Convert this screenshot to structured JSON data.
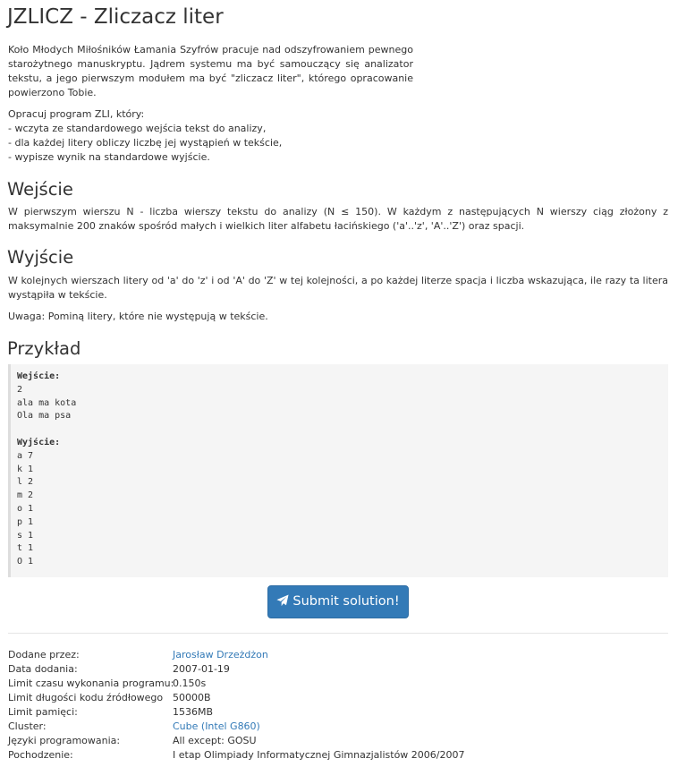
{
  "title": "JZLICZ - Zliczacz liter",
  "intro": "Koło Młodych Miłośników Łamania Szyfrów pracuje nad odszyfrowaniem pewnego starożytnego manuskryptu. Jądrem systemu ma być samouczący się analizator tekstu, a jego pierwszym modułem ma być \"zliczacz liter\", którego opracowanie powierzono Tobie.",
  "task": {
    "lead": "Opracuj program ZLI, który:",
    "items": [
      "- wczyta ze standardowego wejścia tekst do analizy,",
      "- dla każdej litery obliczy liczbę jej wystąpień w tekście,",
      "- wypisze wynik na standardowe wyjście."
    ]
  },
  "input_section": {
    "heading": "Wejście",
    "text": "W pierwszym wierszu N - liczba wierszy tekstu do analizy (N ≤ 150). W każdym z następujących N wierszy ciąg złożony z maksymalnie 200 znaków spośród małych i wielkich liter alfabetu łacińskiego ('a'..'z', 'A'..'Z') oraz spacji."
  },
  "output_section": {
    "heading": "Wyjście",
    "text": "W kolejnych wierszach litery od 'a' do 'z' i od 'A' do 'Z' w tej kolejności, a po każdej literze spacja i liczba wskazująca, ile razy ta litera wystąpiła w tekście.",
    "note": "Uwaga: Pominą litery, które nie występują w tekście."
  },
  "example": {
    "heading": "Przykład",
    "input_label": "Wejście:",
    "input_lines": [
      "2",
      "ala ma kota",
      "Ola ma psa"
    ],
    "output_label": "Wyjście:",
    "output_lines": [
      "a 7",
      "k 1",
      "l 2",
      "m 2",
      "o 1",
      "p 1",
      "s 1",
      "t 1",
      "O 1"
    ]
  },
  "submit_label": "Submit solution!",
  "meta": [
    {
      "key": "Dodane przez:",
      "value": "Jarosław Drzeżdżon",
      "link": true
    },
    {
      "key": "Data dodania:",
      "value": "2007-01-19",
      "link": false
    },
    {
      "key": "Limit czasu wykonania programu:",
      "value": "0.150s",
      "link": false
    },
    {
      "key": "Limit długości kodu źródłowego",
      "value": "50000B",
      "link": false
    },
    {
      "key": "Limit pamięci:",
      "value": "1536MB",
      "link": false
    },
    {
      "key": "Cluster:",
      "value": "Cube (Intel G860)",
      "link": true
    },
    {
      "key": "Języki programowania:",
      "value": "All except: GOSU",
      "link": false
    },
    {
      "key": "Pochodzenie:",
      "value": "I etap Olimpiady Informatycznej Gimnazjalistów 2006/2007",
      "link": false
    }
  ],
  "colors": {
    "accent": "#337ab7",
    "text": "#333333",
    "code_bg": "#f5f5f5"
  },
  "icons": {
    "submit": "paper-plane-icon"
  }
}
